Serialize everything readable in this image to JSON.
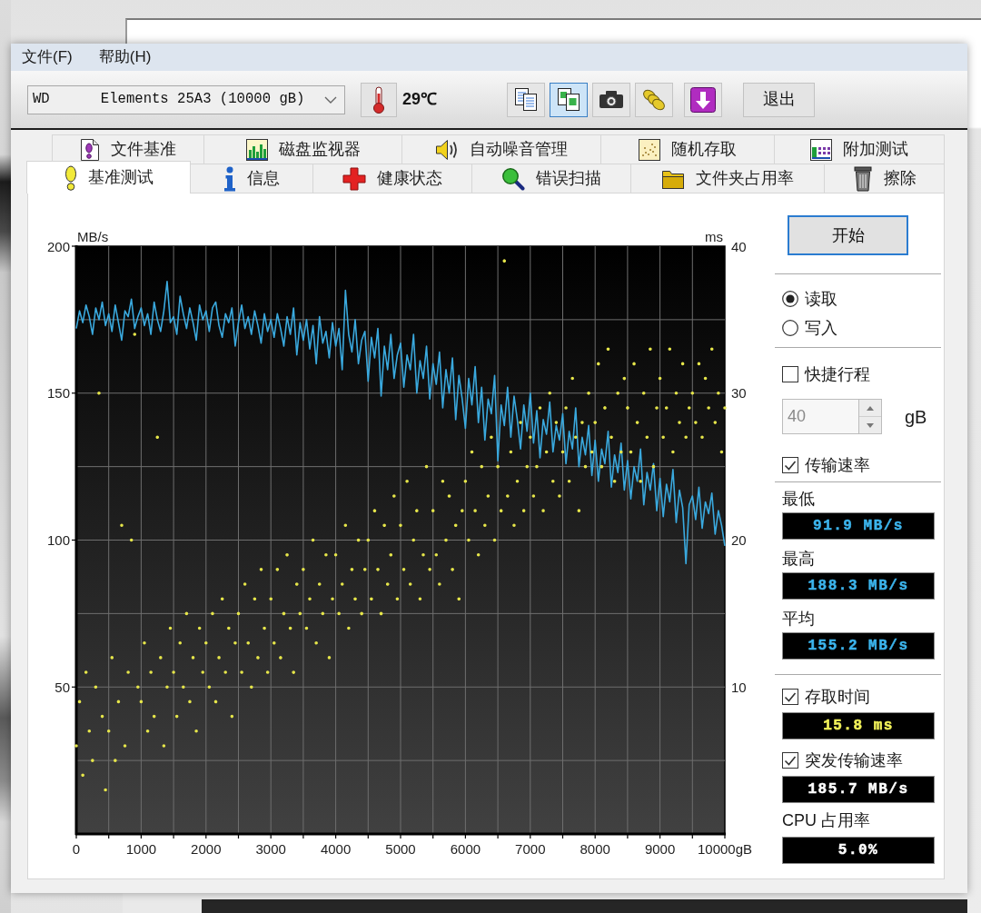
{
  "menu": [
    "文件(F)",
    "帮助(H)"
  ],
  "toolbar": {
    "drive": "WD      Elements 25A3 (10000 gB)",
    "temperature": "29℃",
    "tool_buttons": [
      {
        "selected": false
      },
      {
        "selected": true
      },
      {
        "selected": false
      },
      {
        "selected": false
      },
      {
        "selected": false
      }
    ],
    "exit_button": "退出"
  },
  "tab_rows": [
    {
      "tabs": [
        {
          "label": "文件基准",
          "selected": false
        },
        {
          "label": "磁盘监视器",
          "selected": false
        },
        {
          "label": "自动噪音管理",
          "selected": false
        },
        {
          "label": "随机存取",
          "selected": false
        },
        {
          "label": "附加测试",
          "selected": false
        }
      ]
    },
    {
      "tabs": [
        {
          "label": "基准测试",
          "selected": true
        },
        {
          "label": "信息",
          "selected": false
        },
        {
          "label": "健康状态",
          "selected": false
        },
        {
          "label": "错误扫描",
          "selected": false
        },
        {
          "label": "文件夹占用率",
          "selected": false
        },
        {
          "label": "擦除",
          "selected": false
        }
      ]
    }
  ],
  "benchmark": {
    "chart_data": {
      "type": "line",
      "ylabel": "MB/s",
      "y2label": "ms",
      "grid": true,
      "xlim": [
        0,
        10000
      ],
      "ylim": [
        0,
        200
      ],
      "y2lim": [
        0,
        40
      ],
      "xticks": [
        0,
        1000,
        2000,
        3000,
        4000,
        5000,
        6000,
        7000,
        8000,
        9000,
        {
          "value": 10000,
          "label": "10000gB"
        }
      ],
      "yticks": [
        50,
        100,
        150,
        200
      ],
      "y2ticks": [
        10,
        20,
        30,
        40
      ],
      "x": [
        0,
        50,
        100,
        150,
        200,
        250,
        300,
        350,
        400,
        450,
        500,
        550,
        600,
        650,
        700,
        750,
        800,
        850,
        900,
        950,
        1000,
        1050,
        1100,
        1150,
        1200,
        1250,
        1300,
        1350,
        1400,
        1450,
        1500,
        1550,
        1600,
        1650,
        1700,
        1750,
        1800,
        1850,
        1900,
        1950,
        2000,
        2050,
        2100,
        2150,
        2200,
        2250,
        2300,
        2350,
        2400,
        2450,
        2500,
        2550,
        2600,
        2650,
        2700,
        2750,
        2800,
        2850,
        2900,
        2950,
        3000,
        3050,
        3100,
        3150,
        3200,
        3250,
        3300,
        3350,
        3400,
        3450,
        3500,
        3550,
        3600,
        3650,
        3700,
        3750,
        3800,
        3850,
        3900,
        3950,
        4000,
        4050,
        4100,
        4150,
        4200,
        4250,
        4300,
        4350,
        4400,
        4450,
        4500,
        4550,
        4600,
        4650,
        4700,
        4750,
        4800,
        4850,
        4900,
        4950,
        5000,
        5050,
        5100,
        5150,
        5200,
        5250,
        5300,
        5350,
        5400,
        5450,
        5500,
        5550,
        5600,
        5650,
        5700,
        5750,
        5800,
        5850,
        5900,
        5950,
        6000,
        6050,
        6100,
        6150,
        6200,
        6250,
        6300,
        6350,
        6400,
        6450,
        6500,
        6550,
        6600,
        6650,
        6700,
        6750,
        6800,
        6850,
        6900,
        6950,
        7000,
        7050,
        7100,
        7150,
        7200,
        7250,
        7300,
        7350,
        7400,
        7450,
        7500,
        7550,
        7600,
        7650,
        7700,
        7750,
        7800,
        7850,
        7900,
        7950,
        8000,
        8050,
        8100,
        8150,
        8200,
        8250,
        8300,
        8350,
        8400,
        8450,
        8500,
        8550,
        8600,
        8650,
        8700,
        8750,
        8800,
        8850,
        8900,
        8950,
        9000,
        9050,
        9100,
        9150,
        9200,
        9250,
        9300,
        9350,
        9400,
        9450,
        9500,
        9550,
        9600,
        9650,
        9700,
        9750,
        9800,
        9850,
        9900,
        9950,
        10000
      ],
      "series": [
        {
          "color": "#3aa9de",
          "type": "line",
          "values": [
            172,
            178,
            174,
            180,
            176,
            170,
            179,
            175,
            181,
            173,
            177,
            171,
            180,
            174,
            168,
            178,
            176,
            182,
            172,
            176,
            179,
            173,
            177,
            170,
            181,
            175,
            171,
            178,
            188,
            174,
            176,
            170,
            183,
            177,
            172,
            179,
            174,
            168,
            180,
            175,
            178,
            171,
            179,
            181,
            173,
            169,
            177,
            174,
            179,
            166,
            174,
            180,
            172,
            176,
            170,
            178,
            173,
            167,
            177,
            171,
            175,
            169,
            177,
            172,
            166,
            176,
            170,
            179,
            163,
            174,
            168,
            175,
            165,
            173,
            160,
            176,
            167,
            171,
            162,
            174,
            166,
            172,
            158,
            185,
            170,
            164,
            175,
            160,
            168,
            171,
            154,
            169,
            162,
            172,
            149,
            166,
            158,
            170,
            155,
            163,
            167,
            152,
            163,
            158,
            170,
            150,
            161,
            155,
            166,
            148,
            160,
            153,
            164,
            145,
            158,
            150,
            162,
            141,
            156,
            148,
            138,
            155,
            146,
            159,
            140,
            152,
            134,
            148,
            143,
            156,
            127,
            146,
            139,
            152,
            135,
            149,
            141,
            131,
            146,
            137,
            150,
            133,
            144,
            128,
            141,
            136,
            147,
            130,
            139,
            134,
            143,
            126,
            137,
            131,
            145,
            125,
            135,
            129,
            139,
            122,
            134,
            120,
            131,
            126,
            137,
            118,
            129,
            123,
            133,
            117,
            127,
            114,
            125,
            120,
            131,
            112,
            123,
            117,
            126,
            110,
            121,
            108,
            119,
            113,
            124,
            106,
            117,
            111,
            92,
            112,
            115,
            107,
            118,
            104,
            113,
            109,
            116,
            102,
            110,
            105,
            98
          ]
        },
        {
          "color": "#e6e64a",
          "type": "scatter",
          "axis": "y2",
          "values": [
            6,
            9,
            4,
            11,
            7,
            5,
            10,
            30,
            8,
            3,
            7,
            12,
            5,
            9,
            21,
            6,
            11,
            20,
            34,
            10,
            9,
            13,
            7,
            11,
            8,
            27,
            12,
            6,
            10,
            14,
            11,
            8,
            13,
            10,
            15,
            9,
            12,
            7,
            14,
            11,
            13,
            10,
            15,
            9,
            12,
            16,
            11,
            14,
            8,
            13,
            15,
            11,
            17,
            13,
            10,
            16,
            12,
            18,
            14,
            11,
            16,
            13,
            18,
            12,
            15,
            19,
            14,
            11,
            17,
            15,
            18,
            14,
            16,
            20,
            13,
            17,
            15,
            19,
            12,
            16,
            19,
            15,
            17,
            21,
            14,
            18,
            16,
            20,
            15,
            18,
            20,
            16,
            22,
            18,
            15,
            21,
            17,
            19,
            23,
            16,
            21,
            18,
            24,
            17,
            20,
            22,
            16,
            19,
            25,
            18,
            22,
            19,
            17,
            24,
            20,
            23,
            18,
            21,
            16,
            22,
            24,
            20,
            26,
            22,
            19,
            25,
            21,
            23,
            27,
            20,
            25,
            22,
            39,
            23,
            26,
            21,
            24,
            28,
            22,
            25,
            27,
            23,
            25,
            29,
            22,
            26,
            30,
            24,
            28,
            23,
            26,
            29,
            24,
            31,
            27,
            22,
            28,
            25,
            30,
            26,
            28,
            32,
            25,
            29,
            33,
            27,
            24,
            30,
            26,
            31,
            29,
            26,
            32,
            28,
            24,
            30,
            27,
            33,
            25,
            29,
            31,
            27,
            29,
            33,
            26,
            30,
            28,
            32,
            27,
            29,
            30,
            28,
            32,
            27,
            31,
            29,
            33,
            28,
            30,
            26,
            29
          ]
        }
      ]
    },
    "side_panel": {
      "start_button": "开始",
      "mode": [
        {
          "label": "读取",
          "selected": true
        },
        {
          "label": "写入",
          "selected": false
        }
      ],
      "short_stroke": {
        "label": "快捷行程",
        "checked": false,
        "value": "40",
        "disabled": true,
        "unit": "gB"
      },
      "measures": [
        {
          "kind": "checkbox",
          "label": "传输速率",
          "checked": true,
          "readouts": [
            {
              "label": "最低",
              "value": "91.9 MB/s",
              "color": "#3cb4ec"
            },
            {
              "label": "最高",
              "value": "188.3 MB/s",
              "color": "#3cb4ec"
            },
            {
              "label": "平均",
              "value": "155.2 MB/s",
              "color": "#3cb4ec"
            }
          ]
        },
        {
          "kind": "checkbox",
          "label": "存取时间",
          "checked": true,
          "readouts": [
            {
              "value": "15.8 ms",
              "color": "#f2f25a"
            }
          ]
        },
        {
          "kind": "checkbox",
          "label": "突发传输速率",
          "checked": true,
          "readouts": [
            {
              "value": "185.7 MB/s",
              "color": "#ffffff"
            }
          ]
        },
        {
          "kind": "label",
          "label": "CPU 占用率",
          "readouts": [
            {
              "value": "5.0%",
              "color": "#ffffff"
            }
          ]
        }
      ]
    }
  }
}
